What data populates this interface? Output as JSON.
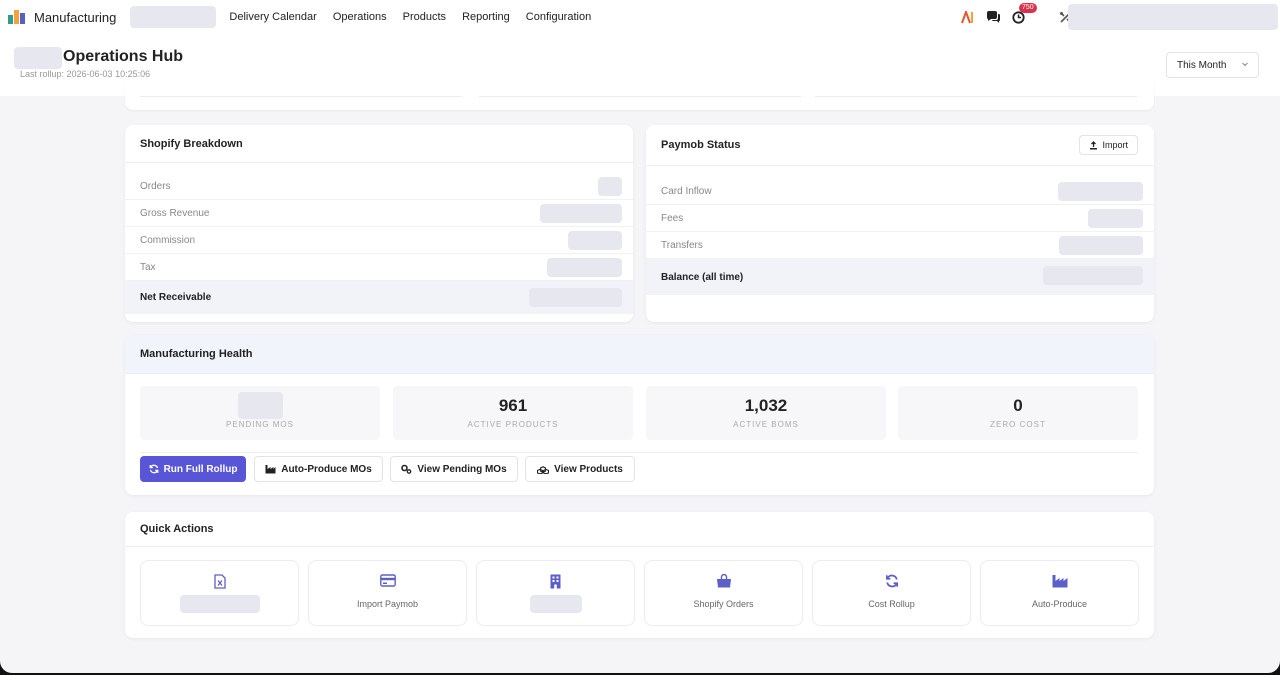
{
  "app": {
    "name": "Manufacturing",
    "nav": [
      "Delivery Calendar",
      "Operations",
      "Products",
      "Reporting",
      "Configuration"
    ],
    "notification_badge": "750"
  },
  "page": {
    "title": "Operations Hub",
    "last_rollup": "Last rollup: 2026-06-03 10:25:06",
    "period_select": "This Month"
  },
  "shopify": {
    "title": "Shopify Breakdown",
    "rows": [
      "Orders",
      "Gross Revenue",
      "Commission",
      "Tax"
    ],
    "total_label": "Net Receivable"
  },
  "paymob": {
    "title": "Paymob Status",
    "import_label": "Import",
    "rows": [
      "Card Inflow",
      "Fees",
      "Transfers"
    ],
    "total_label": "Balance (all time)"
  },
  "manufacturing_health": {
    "title": "Manufacturing Health",
    "stats": [
      {
        "value": "",
        "label": "PENDING MOS"
      },
      {
        "value": "961",
        "label": "ACTIVE PRODUCTS"
      },
      {
        "value": "1,032",
        "label": "ACTIVE BOMS"
      },
      {
        "value": "0",
        "label": "ZERO COST"
      }
    ],
    "buttons": [
      "Run Full Rollup",
      "Auto-Produce MOs",
      "View Pending MOs",
      "View Products"
    ]
  },
  "quick_actions": {
    "title": "Quick Actions",
    "items": [
      {
        "label": "",
        "icon": "excel-file-icon"
      },
      {
        "label": "Import Paymob",
        "icon": "credit-card-icon"
      },
      {
        "label": "",
        "icon": "building-icon"
      },
      {
        "label": "Shopify Orders",
        "icon": "shopping-bag-icon"
      },
      {
        "label": "Cost Rollup",
        "icon": "refresh-icon"
      },
      {
        "label": "Auto-Produce",
        "icon": "factory-icon"
      }
    ]
  },
  "colors": {
    "primary": "#5856d6",
    "icon_accent": "#5c5fc9",
    "badge": "#d9324a",
    "placeholder": "#e7e8ef"
  }
}
